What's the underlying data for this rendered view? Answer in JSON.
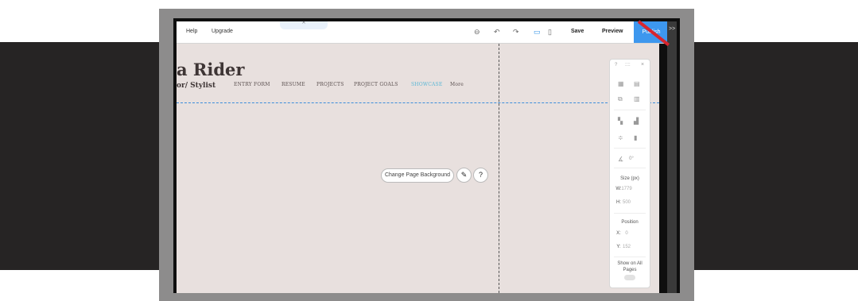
{
  "toolbar": {
    "help_label": "Help",
    "upgrade_label": "Upgrade",
    "notch_label": "^",
    "save_label": "Save",
    "preview_label": "Preview",
    "publish_label": "Publish",
    "collapse_label": ">>",
    "icons": [
      "zoom-out-icon",
      "undo-icon",
      "redo-icon",
      "desktop-icon",
      "mobile-icon"
    ]
  },
  "site": {
    "logo_text": "a Rider",
    "subtitle": "or/ Stylist",
    "nav": [
      {
        "label": "ENTRY FORM",
        "active": false
      },
      {
        "label": "RESUME",
        "active": false
      },
      {
        "label": "PROJECTS",
        "active": false
      },
      {
        "label": "PROJECT GOALS",
        "active": false
      },
      {
        "label": "SHOWCASE",
        "active": true
      },
      {
        "label": "More",
        "active": false
      }
    ]
  },
  "canvas": {
    "change_bg_label": "Change Page Background",
    "brush_glyph": "✎",
    "help_glyph": "?"
  },
  "panel": {
    "help_glyph": "?",
    "grip_glyph": "::::",
    "close_glyph": "×",
    "rotate_value": "0°",
    "size_label": "Size (px)",
    "width_label": "W:",
    "width_value": "1779",
    "height_label": "H:",
    "height_value": "500",
    "position_label": "Position",
    "x_label": "X:",
    "x_value": "0",
    "y_label": "Y:",
    "y_value": "152",
    "show_all_label": "Show on All Pages"
  },
  "colors": {
    "canvas_bg": "#e8e0de",
    "accent": "#3d97ee",
    "nav_active": "#5ab7d6",
    "slash": "#d8262e"
  }
}
